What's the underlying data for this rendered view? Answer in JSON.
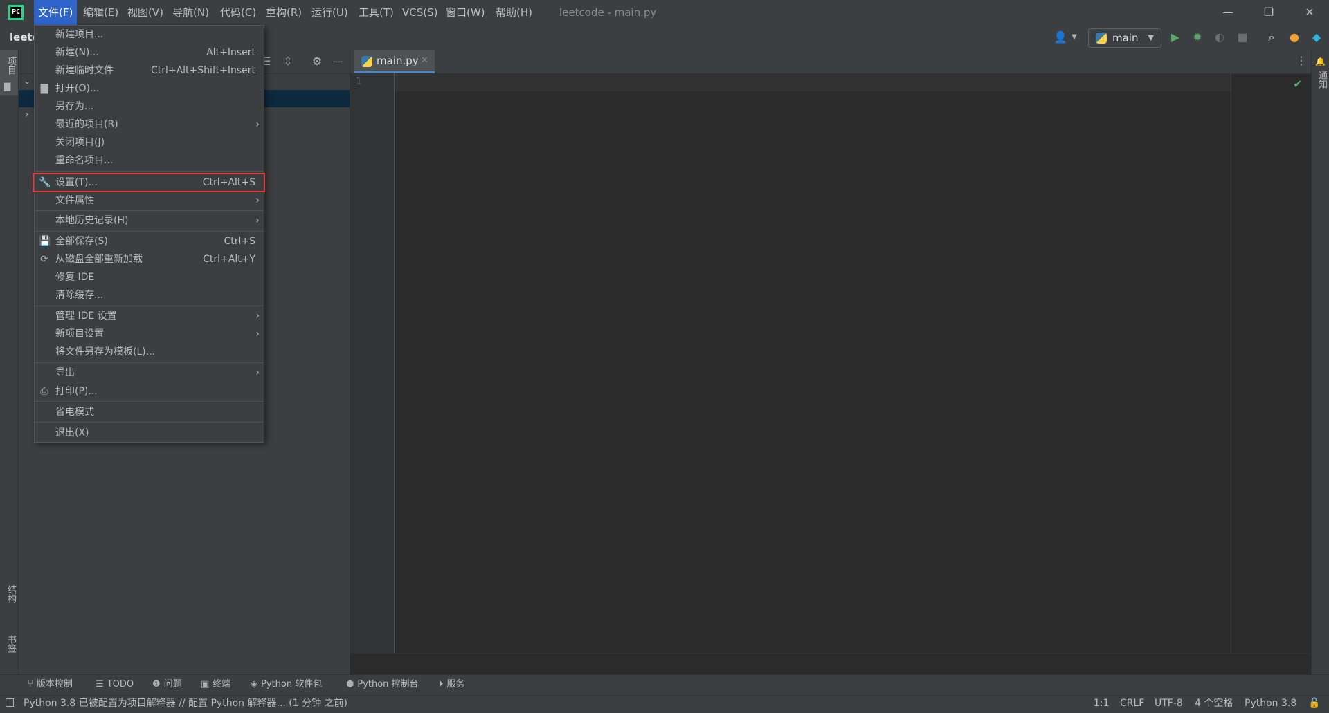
{
  "window": {
    "title": "leetcode - main.py",
    "controls": {
      "minimize": "—",
      "restore": "❐",
      "close": "✕"
    }
  },
  "menubar": {
    "items": [
      "文件(F)",
      "编辑(E)",
      "视图(V)",
      "导航(N)",
      "代码(C)",
      "重构(R)",
      "运行(U)",
      "工具(T)",
      "VCS(S)",
      "窗口(W)",
      "帮助(H)"
    ]
  },
  "toolbar": {
    "project_name": "leetc",
    "run_config": "main"
  },
  "left_strip": {
    "project_tab": "项目",
    "structure_tab": "结构",
    "bookmarks_tab": "书签"
  },
  "right_strip": {
    "notifications_tab": "通知"
  },
  "editor": {
    "tab_label": "main.py",
    "line_numbers": [
      "1"
    ]
  },
  "file_menu": {
    "items": [
      {
        "label": "新建项目...",
        "shortcut": "",
        "icon": "",
        "submenu": false
      },
      {
        "label": "新建(N)...",
        "shortcut": "Alt+Insert",
        "icon": "",
        "submenu": false
      },
      {
        "label": "新建临时文件",
        "shortcut": "Ctrl+Alt+Shift+Insert",
        "icon": "",
        "submenu": false
      },
      {
        "label": "打开(O)...",
        "shortcut": "",
        "icon": "folder-icon",
        "submenu": false
      },
      {
        "label": "另存为...",
        "shortcut": "",
        "icon": "",
        "submenu": false
      },
      {
        "label": "最近的项目(R)",
        "shortcut": "",
        "icon": "",
        "submenu": true
      },
      {
        "label": "关闭项目(J)",
        "shortcut": "",
        "icon": "",
        "submenu": false
      },
      {
        "label": "重命名项目...",
        "shortcut": "",
        "icon": "",
        "submenu": false
      },
      {
        "label": "设置(T)...",
        "shortcut": "Ctrl+Alt+S",
        "icon": "wrench-icon",
        "submenu": false
      },
      {
        "label": "文件属性",
        "shortcut": "",
        "icon": "",
        "submenu": true
      },
      {
        "label": "本地历史记录(H)",
        "shortcut": "",
        "icon": "",
        "submenu": true
      },
      {
        "label": "全部保存(S)",
        "shortcut": "Ctrl+S",
        "icon": "save-icon",
        "submenu": false
      },
      {
        "label": "从磁盘全部重新加载",
        "shortcut": "Ctrl+Alt+Y",
        "icon": "reload-icon",
        "submenu": false
      },
      {
        "label": "修复 IDE",
        "shortcut": "",
        "icon": "",
        "submenu": false
      },
      {
        "label": "清除缓存...",
        "shortcut": "",
        "icon": "",
        "submenu": false
      },
      {
        "label": "管理 IDE 设置",
        "shortcut": "",
        "icon": "",
        "submenu": true
      },
      {
        "label": "新项目设置",
        "shortcut": "",
        "icon": "",
        "submenu": true
      },
      {
        "label": "将文件另存为模板(L)...",
        "shortcut": "",
        "icon": "",
        "submenu": false
      },
      {
        "label": "导出",
        "shortcut": "",
        "icon": "",
        "submenu": true
      },
      {
        "label": "打印(P)...",
        "shortcut": "",
        "icon": "print-icon",
        "submenu": false
      },
      {
        "label": "省电模式",
        "shortcut": "",
        "icon": "",
        "submenu": false
      },
      {
        "label": "退出(X)",
        "shortcut": "",
        "icon": "",
        "submenu": false
      }
    ]
  },
  "bottom_tools": {
    "items": [
      {
        "label": "版本控制",
        "icon": "branch-icon"
      },
      {
        "label": "TODO",
        "icon": "list-icon"
      },
      {
        "label": "问题",
        "icon": "info-icon"
      },
      {
        "label": "终端",
        "icon": "terminal-icon"
      },
      {
        "label": "Python 软件包",
        "icon": "layers-icon"
      },
      {
        "label": "Python 控制台",
        "icon": "python-icon"
      },
      {
        "label": "服务",
        "icon": "play-circle-icon"
      }
    ]
  },
  "statusbar": {
    "message": "Python 3.8 已被配置为项目解释器 // 配置 Python 解释器... (1 分钟 之前)",
    "position": "1:1",
    "line_separator": "CRLF",
    "encoding": "UTF-8",
    "indent": "4 个空格",
    "interpreter": "Python 3.8"
  },
  "colors": {
    "background": "#2b2b2b",
    "chrome": "#3c3f41",
    "menu_active": "#2f65ca",
    "highlight_border": "#e5393a",
    "run_green": "#59a869"
  }
}
